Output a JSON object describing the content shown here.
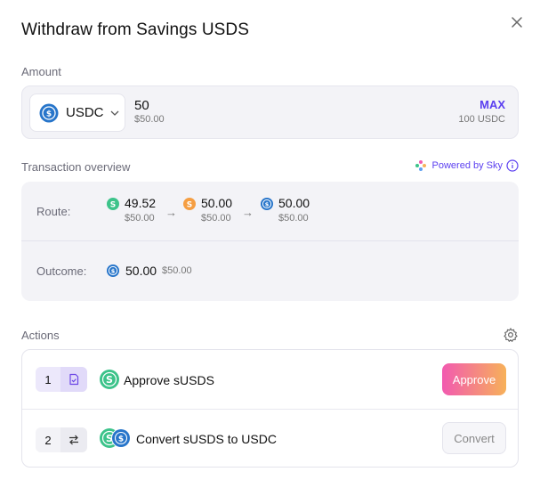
{
  "modal": {
    "title": "Withdraw from Savings USDS"
  },
  "amount": {
    "section_label": "Amount",
    "token": "USDC",
    "value": "50",
    "value_usd": "$50.00",
    "max_label": "MAX",
    "balance": "100 USDC"
  },
  "overview": {
    "section_label": "Transaction overview",
    "powered_by": "Powered by Sky",
    "route_label": "Route:",
    "route": [
      {
        "amount": "49.52",
        "usd": "$50.00",
        "icon": "susds-icon"
      },
      {
        "amount": "50.00",
        "usd": "$50.00",
        "icon": "usds-icon"
      },
      {
        "amount": "50.00",
        "usd": "$50.00",
        "icon": "usdc-icon"
      }
    ],
    "arrow": "→",
    "outcome_label": "Outcome:",
    "outcome_amount": "50.00",
    "outcome_usd": "$50.00"
  },
  "actions": {
    "section_label": "Actions",
    "steps": [
      {
        "number": "1",
        "icon": "approve-doc-icon",
        "label": "Approve sUSDS",
        "button": "Approve"
      },
      {
        "number": "2",
        "icon": "swap-arrows-icon",
        "label": "Convert sUSDS to USDC",
        "button": "Convert"
      }
    ]
  },
  "colors": {
    "accent": "#5b3ff0",
    "susds_green": "#3cc38a",
    "usds_orange": "#f59e42",
    "usdc_blue": "#2775ca",
    "approve_gradient_start": "#f25ab0",
    "approve_gradient_end": "#f7b159"
  }
}
